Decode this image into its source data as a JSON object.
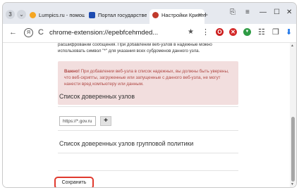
{
  "tabs": {
    "count": "3",
    "menu_glyph": "⌄",
    "items": [
      {
        "title": "Lumpics.ru - помощь с...",
        "favicon_color": "#f5a623"
      },
      {
        "title": "Портал государственн...",
        "favicon_color": "#1d4bb0"
      },
      {
        "title": "Настройки КриптоПро",
        "favicon_color": "#c0392b"
      }
    ],
    "new_tab": "+"
  },
  "window": {
    "minimize": "—",
    "restore": "☐",
    "close": "✕",
    "menu": "≡",
    "bookmark": "⎘"
  },
  "nav": {
    "back": "←",
    "reload": "C",
    "url": "chrome-extension://epebfcehmded...",
    "bookmark_star": "★",
    "more": "⋮",
    "downloads": "⬇",
    "bookmarks": "☷"
  },
  "extensions": [
    {
      "name": "opera-icon",
      "color": "#cc1f1f",
      "glyph": "O"
    },
    {
      "name": "red-x-icon",
      "color": "#d42a2a",
      "glyph": "✕"
    },
    {
      "name": "shield-icon",
      "color": "#2e9b44",
      "glyph": "▼"
    }
  ],
  "content": {
    "intro": "расшифровании сообщения. При добавлении веб-узлов в надежные можно использовать символ \"*\" для указания всех субдоменов данного узла.",
    "warning_label": "Важно!",
    "warning_text": "При добавлении веб-узла в список надежных, вы должны быть уверены, что веб-скрипты, загруженные или запущенные с данного веб-узла, не могут нанести вред компьютеру или данным.",
    "trusted_heading": "Список доверенных узлов",
    "trusted_input_value": "https://*.gov.ru",
    "add_button": "+",
    "group_heading": "Список доверенных узлов групповой политики",
    "save_button": "Сохранить"
  },
  "colors": {
    "accent": "#e03a2e",
    "warning_bg": "#f2dede",
    "warning_text": "#b04a46"
  }
}
